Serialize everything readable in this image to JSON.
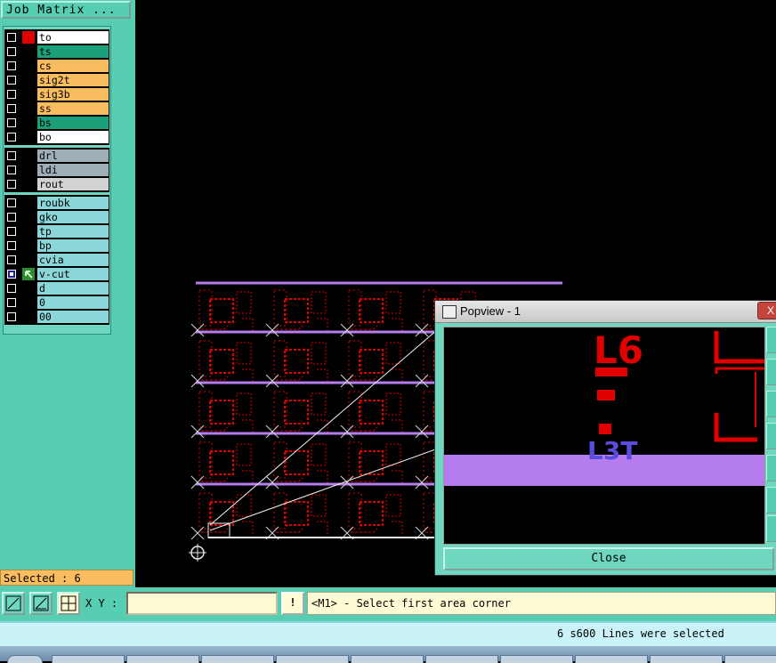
{
  "panel": {
    "title": "Job Matrix ..."
  },
  "colors": {
    "green": "#1ba07a",
    "orange": "#f9bc5e",
    "white": "#ffffff",
    "gray": "#9eaeb6",
    "lightgray": "#d2d2d2",
    "cyan": "#8ad6d8",
    "red": "#e00000",
    "purple": "#b57cf0"
  },
  "layers": [
    {
      "name": "to",
      "color": "white",
      "checked": false,
      "swatch": "red"
    },
    {
      "name": "ts",
      "color": "green",
      "checked": false,
      "swatch": ""
    },
    {
      "name": "cs",
      "color": "orange",
      "checked": false,
      "swatch": ""
    },
    {
      "name": "sig2t",
      "color": "orange",
      "checked": false,
      "swatch": ""
    },
    {
      "name": "sig3b",
      "color": "orange",
      "checked": false,
      "swatch": ""
    },
    {
      "name": "ss",
      "color": "orange",
      "checked": false,
      "swatch": ""
    },
    {
      "name": "bs",
      "color": "green",
      "checked": false,
      "swatch": ""
    },
    {
      "name": "bo",
      "color": "white",
      "checked": false,
      "swatch": ""
    },
    {
      "name": "drl",
      "color": "gray",
      "checked": false,
      "swatch": ""
    },
    {
      "name": "ldi",
      "color": "gray",
      "checked": false,
      "swatch": ""
    },
    {
      "name": "rout",
      "color": "lightgray",
      "checked": false,
      "swatch": ""
    },
    {
      "name": "roubk",
      "color": "cyan",
      "checked": false,
      "swatch": ""
    },
    {
      "name": "gko",
      "color": "cyan",
      "checked": false,
      "swatch": ""
    },
    {
      "name": "tp",
      "color": "cyan",
      "checked": false,
      "swatch": ""
    },
    {
      "name": "bp",
      "color": "cyan",
      "checked": false,
      "swatch": ""
    },
    {
      "name": "cvia",
      "color": "cyan",
      "checked": false,
      "swatch": ""
    },
    {
      "name": "v-cut",
      "color": "cyan",
      "checked": true,
      "swatch": "work-layer-arrow-icon",
      "expand": true
    },
    {
      "name": "d",
      "color": "cyan",
      "checked": false,
      "swatch": ""
    },
    {
      "name": "0",
      "color": "cyan",
      "checked": false,
      "swatch": ""
    },
    {
      "name": "00",
      "color": "cyan",
      "checked": false,
      "swatch": ""
    }
  ],
  "selected": {
    "label": "Selected : 6"
  },
  "popview": {
    "title": "Popview - 1",
    "close_label": "Close",
    "close_x": "X",
    "text_l6": "L6",
    "text_l3t": "L3T"
  },
  "toolbar": {
    "xy_label": "X Y :",
    "xy_value": "",
    "alert_glyph": "!",
    "prompt": "<M1> - Select first area corner"
  },
  "status": {
    "message": "6 s600 Lines were selected"
  }
}
